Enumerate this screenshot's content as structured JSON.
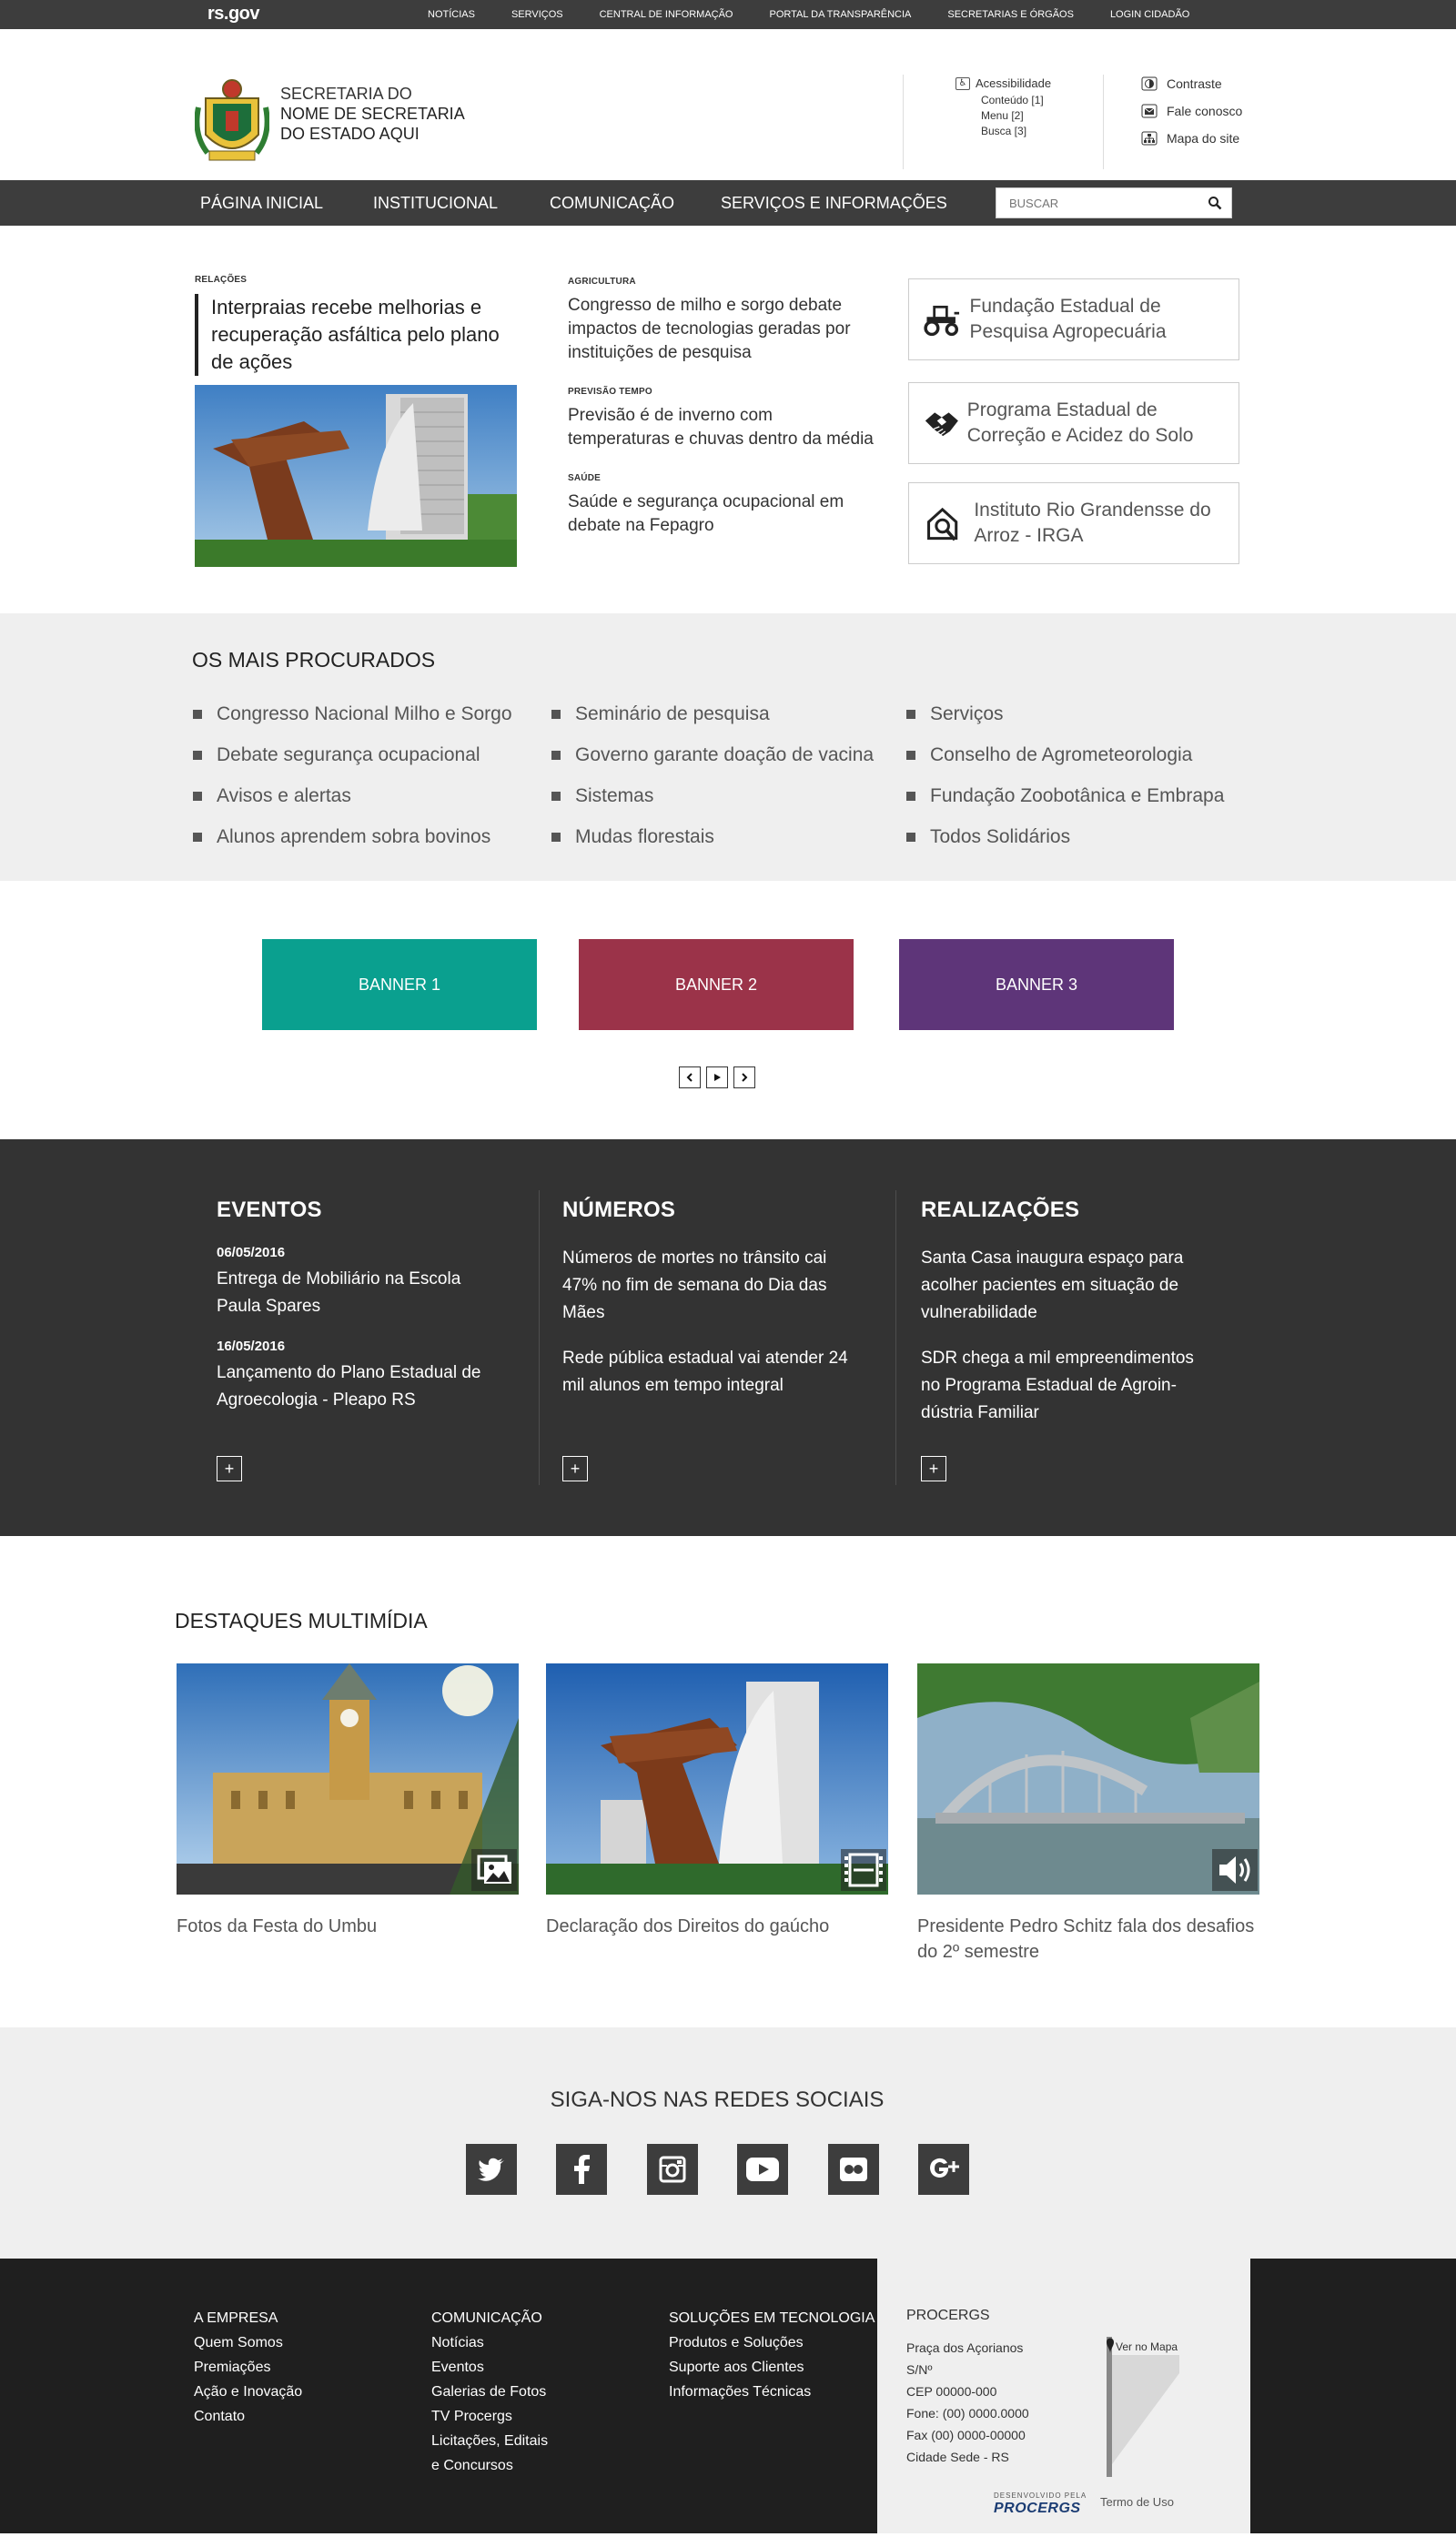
{
  "topbar": {
    "logo": "rs.gov",
    "links": [
      "NOTÍCIAS",
      "SERVIÇOS",
      "CENTRAL DE INFORMAÇÃO",
      "PORTAL DA TRANSPARÊNCIA",
      "SECRETARIAS E ÓRGÃOS",
      "LOGIN CIDADÃO"
    ]
  },
  "header": {
    "title_line1": "SECRETARIA DO",
    "title_line2": "NOME DE SECRETARIA",
    "title_line3": "DO ESTADO AQUI",
    "accessibility": {
      "label": "Acessibilidade",
      "items": [
        "Conteúdo [1]",
        "Menu [2]",
        "Busca [3]"
      ]
    },
    "utility": {
      "contrast": "Contraste",
      "contact": "Fale conosco",
      "sitemap": "Mapa do site"
    }
  },
  "nav": {
    "items": [
      "PÁGINA INICIAL",
      "INSTITUCIONAL",
      "COMUNICAÇÃO",
      "SERVIÇOS E INFORMAÇÕES"
    ],
    "search_placeholder": "BUSCAR"
  },
  "news": {
    "lead": {
      "kicker": "RELAÇÕES",
      "headline": "Interpraias recebe melhorias e recuperação asfáltica pelo plano de ações"
    },
    "items": [
      {
        "kicker": "AGRICULTURA",
        "title": "Congresso de milho e sorgo debate impactos de tecnologias geradas por instituições de pesquisa"
      },
      {
        "kicker": "PREVISÃO TEMPO",
        "title": "Previsão é de inverno com temperaturas e chuvas dentro da média"
      },
      {
        "kicker": "SAÚDE",
        "title": "Saúde e segurança ocupacional em debate na Fepagro"
      }
    ],
    "institutions": [
      {
        "name": "Fundação Estadual de Pesquisa Agropecuária",
        "icon": "tractor-icon"
      },
      {
        "name": "Programa Estadual de Correção e Acidez do Solo",
        "icon": "handshake-icon"
      },
      {
        "name": "Instituto Rio Grandensse do Arroz - IRGA",
        "icon": "house-search-icon"
      }
    ]
  },
  "most_searched": {
    "title": "OS MAIS PROCURADOS",
    "columns": [
      [
        "Congresso Nacional Milho e Sorgo",
        "Debate segurança ocupacional",
        "Avisos e alertas",
        "Alunos aprendem sobra bovinos"
      ],
      [
        "Seminário de pesquisa",
        "Governo garante doação de vacina",
        "Sistemas",
        "Mudas florestais"
      ],
      [
        "Serviços",
        "Conselho de Agrometeorologia",
        "Fundação Zoobotânica e Embrapa",
        "Todos Solidários"
      ]
    ]
  },
  "banners": {
    "items": [
      {
        "label": "BANNER 1",
        "color": "#0aa08f"
      },
      {
        "label": "BANNER 2",
        "color": "#9b3349"
      },
      {
        "label": "BANNER 3",
        "color": "#5e3579"
      }
    ],
    "controls": [
      "prev",
      "play",
      "next"
    ]
  },
  "dark_section": {
    "events": {
      "title": "EVENTOS",
      "items": [
        {
          "date": "06/05/2016",
          "text": "Entrega de Mobiliário na Escola Paula Spares"
        },
        {
          "date": "16/05/2016",
          "text": "Lançamento do Plano Estadual de Agroecologia - Pleapo RS"
        }
      ]
    },
    "numbers": {
      "title": "NÚMEROS",
      "items": [
        "Números de mortes no trânsito cai 47% no fim de semana do Dia das Mães",
        "Rede pública estadual vai atender 24 mil alunos em tempo integral"
      ]
    },
    "achievements": {
      "title": "REALIZAÇÕES",
      "items": [
        "Santa Casa inaugura espaço para acolher pacientes em situação de vulnerabilidade",
        "SDR chega a mil empreendimentos no Programa Estadual de  Agroin-dústria Familiar"
      ]
    },
    "more_label": "+"
  },
  "multimedia": {
    "title": "DESTAQUES MULTIMÍDIA",
    "items": [
      {
        "caption": "Fotos da Festa do Umbu",
        "type": "photo-gallery-icon"
      },
      {
        "caption": "Declaração dos Direitos do gaúcho",
        "type": "video-icon"
      },
      {
        "caption": "Presidente Pedro Schitz fala dos desafios do 2º semestre",
        "type": "audio-icon"
      }
    ]
  },
  "social": {
    "title": "SIGA-NOS NAS REDES SOCIAIS",
    "networks": [
      "twitter-icon",
      "facebook-icon",
      "instagram-icon",
      "youtube-icon",
      "flickr-icon",
      "google-plus-icon"
    ]
  },
  "footer": {
    "col1": [
      "A EMPRESA",
      "Quem Somos",
      "Premiações",
      "Ação e Inovação",
      "Contato"
    ],
    "col2": [
      "COMUNICAÇÃO",
      "Notícias",
      "Eventos",
      "Galerias de Fotos",
      "TV Procergs",
      "Licitações, Editais",
      "e Concursos"
    ],
    "col3": [
      "SOLUÇÕES EM TECNOLOGIA",
      "Produtos e Soluções",
      "Suporte aos Clientes",
      "Informações Técnicas"
    ],
    "box": {
      "title": "PROCERGS",
      "address": [
        "Praça dos Açorianos",
        "S/Nº",
        "CEP 00000-000",
        "Fone: (00) 0000.0000",
        "Fax (00) 0000-00000",
        "Cidade Sede - RS"
      ],
      "map_link": "Ver no Mapa",
      "developed_by": "DESENVOLVIDO PELA",
      "developer": "PROCERGS",
      "terms": "Termo de Uso"
    }
  }
}
